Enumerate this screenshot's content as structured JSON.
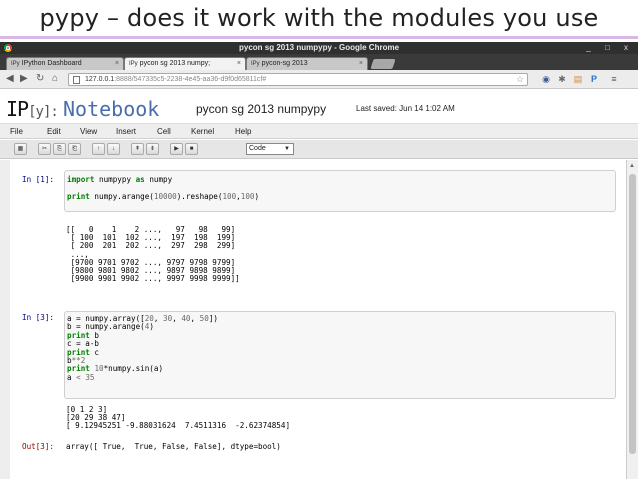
{
  "slide": {
    "title": "pypy – does it work with the modules you use"
  },
  "browser": {
    "window_title": "pycon sg 2013 numpypy - Google Chrome",
    "window_buttons": "_ □ x",
    "tabs": [
      {
        "label": "IPython Dashboard",
        "active": false
      },
      {
        "label": "pycon sg 2013 numpy;",
        "active": true
      },
      {
        "label": "pycon-sg 2013",
        "active": false
      }
    ],
    "tab_icon": "IPy",
    "url_host": "127.0.0.1",
    "url_rest": ":8888/547335c5-2238-4e45-aa36-d9f0d65811cf#",
    "ext_letter": "P"
  },
  "notebook": {
    "logo": "IP",
    "logo_bracket": "[y]:",
    "logo_word": "Notebook",
    "name": "pycon sg 2013 numpypy",
    "saved": "Last saved: Jun 14 1:02 AM",
    "menu": [
      "File",
      "Edit",
      "View",
      "Insert",
      "Cell",
      "Kernel",
      "Help"
    ],
    "toolbar_glyphs": [
      "▦",
      "✂",
      "⎘",
      "⎗",
      "↑",
      "↓",
      "⇞",
      "⇟",
      "▶",
      "■"
    ],
    "cell_type": "Code"
  },
  "cells": {
    "cell1": {
      "prompt": "In [1]:",
      "input": [
        [
          {
            "t": "import",
            "c": "kw"
          },
          {
            "t": " numpypy "
          },
          {
            "t": "as",
            "c": "kw"
          },
          {
            "t": " numpy"
          }
        ],
        [
          {
            "t": ""
          }
        ],
        [
          {
            "t": "print",
            "c": "kw"
          },
          {
            "t": " numpy.arange("
          },
          {
            "t": "10000",
            "c": "num"
          },
          {
            "t": ").reshape("
          },
          {
            "t": "100",
            "c": "num"
          },
          {
            "t": ","
          },
          {
            "t": "100",
            "c": "num"
          },
          {
            "t": ")"
          }
        ]
      ],
      "output": [
        "[[   0    1    2 ...,   97   98   99]",
        " [ 100  101  102 ...,  197  198  199]",
        " [ 200  201  202 ...,  297  298  299]",
        " ...,",
        " [9700 9701 9702 ..., 9797 9798 9799]",
        " [9800 9801 9802 ..., 9897 9898 9899]",
        " [9900 9901 9902 ..., 9997 9998 9999]]"
      ]
    },
    "cell3": {
      "prompt": "In [3]:",
      "input": [
        [
          {
            "t": "a = numpy.array(["
          },
          {
            "t": "20",
            "c": "num"
          },
          {
            "t": ", "
          },
          {
            "t": "30",
            "c": "num"
          },
          {
            "t": ", "
          },
          {
            "t": "40",
            "c": "num"
          },
          {
            "t": ", "
          },
          {
            "t": "50",
            "c": "num"
          },
          {
            "t": "])"
          }
        ],
        [
          {
            "t": "b = numpy.arange("
          },
          {
            "t": "4",
            "c": "num"
          },
          {
            "t": ")"
          }
        ],
        [
          {
            "t": "print",
            "c": "kw"
          },
          {
            "t": " b"
          }
        ],
        [
          {
            "t": "c = a-b"
          }
        ],
        [
          {
            "t": "print",
            "c": "kw"
          },
          {
            "t": " c"
          }
        ],
        [
          {
            "t": "b"
          },
          {
            "t": "**",
            "c": "op"
          },
          {
            "t": "2",
            "c": "num"
          }
        ],
        [
          {
            "t": "print",
            "c": "kw"
          },
          {
            "t": " "
          },
          {
            "t": "10",
            "c": "num"
          },
          {
            "t": "*numpy.sin(a)"
          }
        ],
        [
          {
            "t": "a "
          },
          {
            "t": "<",
            "c": "op"
          },
          {
            "t": " "
          },
          {
            "t": "35",
            "c": "num"
          }
        ]
      ],
      "output": [
        "[0 1 2 3]",
        "[20 29 38 47]",
        "[ 9.12945251 -9.88031624  7.4511316  -2.62374854]"
      ],
      "out_prompt": "Out[3]:",
      "out_value": "array([ True,  True, False, False], dtype=bool)"
    }
  }
}
